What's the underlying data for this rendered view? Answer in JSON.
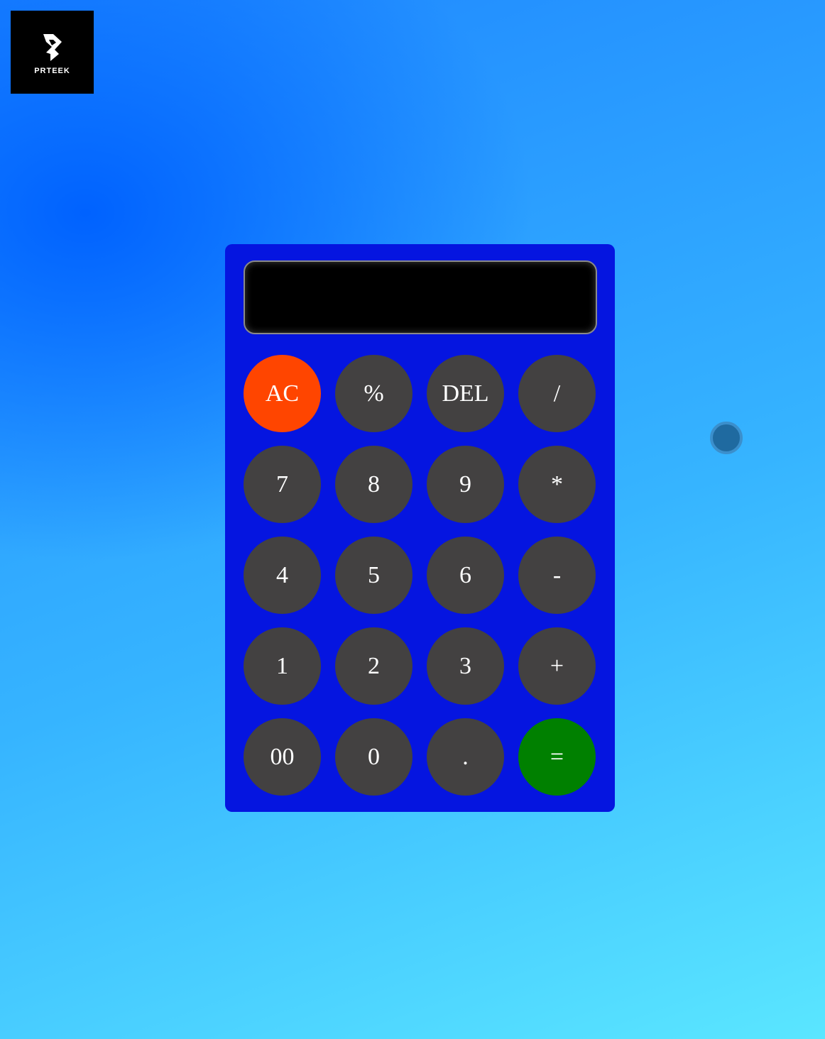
{
  "logo": {
    "text": "PRTEEK",
    "icon": "prteek-logo-icon"
  },
  "display": {
    "value": ""
  },
  "colors": {
    "background_start": "#0062ff",
    "background_end": "#5ae6ff",
    "calculator_body": "#0515e0",
    "key_default": "#434141",
    "key_clear": "#ff4500",
    "key_equals": "#008000",
    "display_bg": "#000000"
  },
  "keys": [
    {
      "label": "AC",
      "name": "clear-button"
    },
    {
      "label": "%",
      "name": "percent-button"
    },
    {
      "label": "DEL",
      "name": "delete-button"
    },
    {
      "label": "/",
      "name": "divide-button"
    },
    {
      "label": "7",
      "name": "digit-7-button"
    },
    {
      "label": "8",
      "name": "digit-8-button"
    },
    {
      "label": "9",
      "name": "digit-9-button"
    },
    {
      "label": "*",
      "name": "multiply-button"
    },
    {
      "label": "4",
      "name": "digit-4-button"
    },
    {
      "label": "5",
      "name": "digit-5-button"
    },
    {
      "label": "6",
      "name": "digit-6-button"
    },
    {
      "label": "-",
      "name": "subtract-button"
    },
    {
      "label": "1",
      "name": "digit-1-button"
    },
    {
      "label": "2",
      "name": "digit-2-button"
    },
    {
      "label": "3",
      "name": "digit-3-button"
    },
    {
      "label": "+",
      "name": "add-button"
    },
    {
      "label": "00",
      "name": "double-zero-button"
    },
    {
      "label": "0",
      "name": "digit-0-button"
    },
    {
      "label": ".",
      "name": "decimal-button"
    },
    {
      "label": "=",
      "name": "equals-button"
    }
  ]
}
